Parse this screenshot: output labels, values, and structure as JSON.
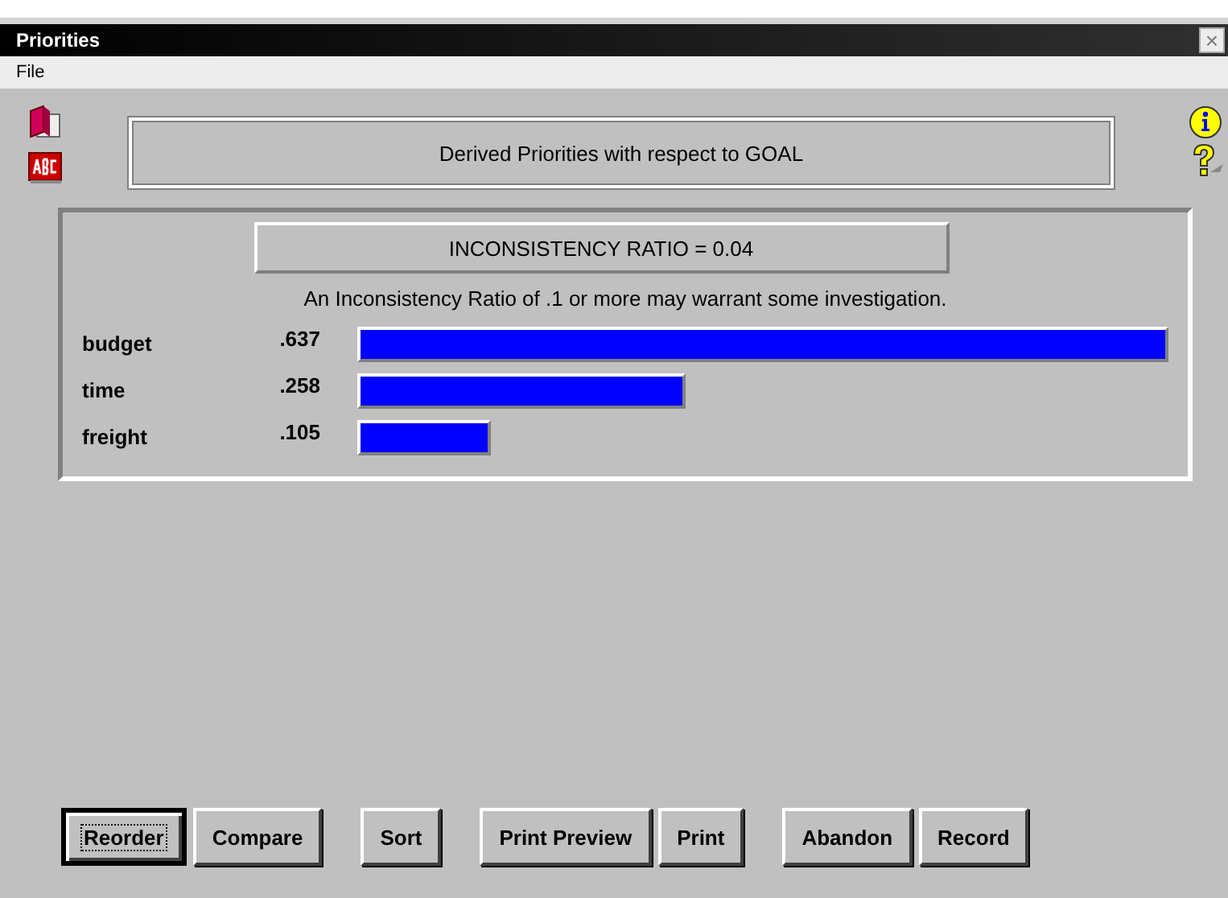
{
  "window": {
    "title": "Priorities",
    "close": "×"
  },
  "menu": [
    "File"
  ],
  "heading": "Derived Priorities with respect to GOAL",
  "ratio": "INCONSISTENCY RATIO = 0.04",
  "note": "An Inconsistency Ratio of .1 or more may warrant some investigation.",
  "priorities": [
    {
      "name": "budget",
      "value": ".637"
    },
    {
      "name": "time",
      "value": ".258"
    },
    {
      "name": "freight",
      "value": ".105"
    }
  ],
  "button_groups": [
    [
      {
        "label": "Reorder",
        "focused": true
      },
      {
        "label": "Compare",
        "focused": false
      }
    ],
    [
      {
        "label": "Sort",
        "focused": false
      }
    ],
    [
      {
        "label": "Print Preview",
        "focused": false
      },
      {
        "label": "Print",
        "focused": false
      }
    ],
    [
      {
        "label": "Abandon",
        "focused": false
      },
      {
        "label": "Record",
        "focused": false
      }
    ]
  ]
}
